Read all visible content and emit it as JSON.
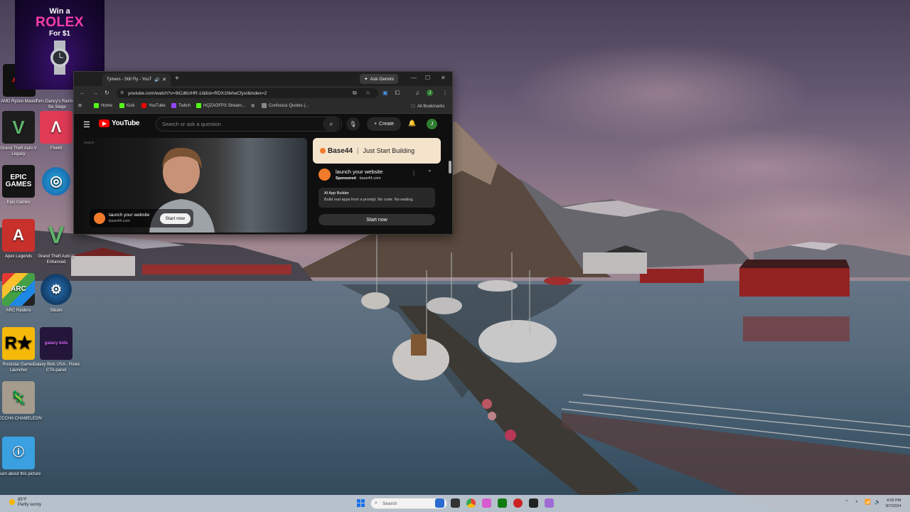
{
  "ad": {
    "line1": "Win a",
    "line2": "ROLEX",
    "line3": "For $1"
  },
  "desktop": {
    "icons": [
      {
        "label": "AMD Ryzen Master"
      },
      {
        "label": "Tom Clancy's Rainbow Six Siege"
      },
      {
        "label": "Grand Theft Auto V Legacy"
      },
      {
        "label": "FiveM"
      },
      {
        "label": "Epic Games"
      },
      {
        "label": ""
      },
      {
        "label": "Apex Legends"
      },
      {
        "label": "Grand Theft Auto V Enhanced"
      },
      {
        "label": "ARC Raiders"
      },
      {
        "label": "Steam"
      },
      {
        "label": "Rockstar Games Launcher"
      },
      {
        "label": "Galaxy Bids USA - Rolex CTA-panel"
      },
      {
        "label": "MECCHA CHAMELEON"
      },
      {
        "label": "Learn about this picture"
      }
    ]
  },
  "browser": {
    "tab_title": "Tymers - Still Fly - YouT",
    "ask_gemini": "Ask Gemini",
    "url": "youtube.com/watch?v=9iCd6UHR-1I&list=RDX1NirlwCfyxI&index=2",
    "bookmarks": [
      "Home",
      "Kick",
      "YouTube",
      "Twitch",
      "HQZAOFPS Stream...",
      "",
      "Confucius Quotes (..."
    ],
    "all_bookmarks": "All Bookmarks"
  },
  "youtube": {
    "logo": "YouTube",
    "search_placeholder": "Search or ask a question",
    "create": "Create",
    "avatar_letter": "J",
    "video_label": "Search",
    "video_ad": {
      "title": "launch your website",
      "domain": "base44.com",
      "button": "Start now"
    },
    "side_ad": {
      "brand": "Base44",
      "tagline": "Just Start Building",
      "title": "launch your website",
      "sponsored": "Sponsored",
      "domain": "base44.com",
      "box_title": "AI App Builder",
      "box_desc": "Build real apps from a prompt. No code. No waiting.",
      "button": "Start now"
    }
  },
  "taskbar": {
    "weather_temp": "85°F",
    "weather_desc": "Partly sunny",
    "search": "Search",
    "time": "4:05 PM",
    "date": "8/7/2024"
  }
}
